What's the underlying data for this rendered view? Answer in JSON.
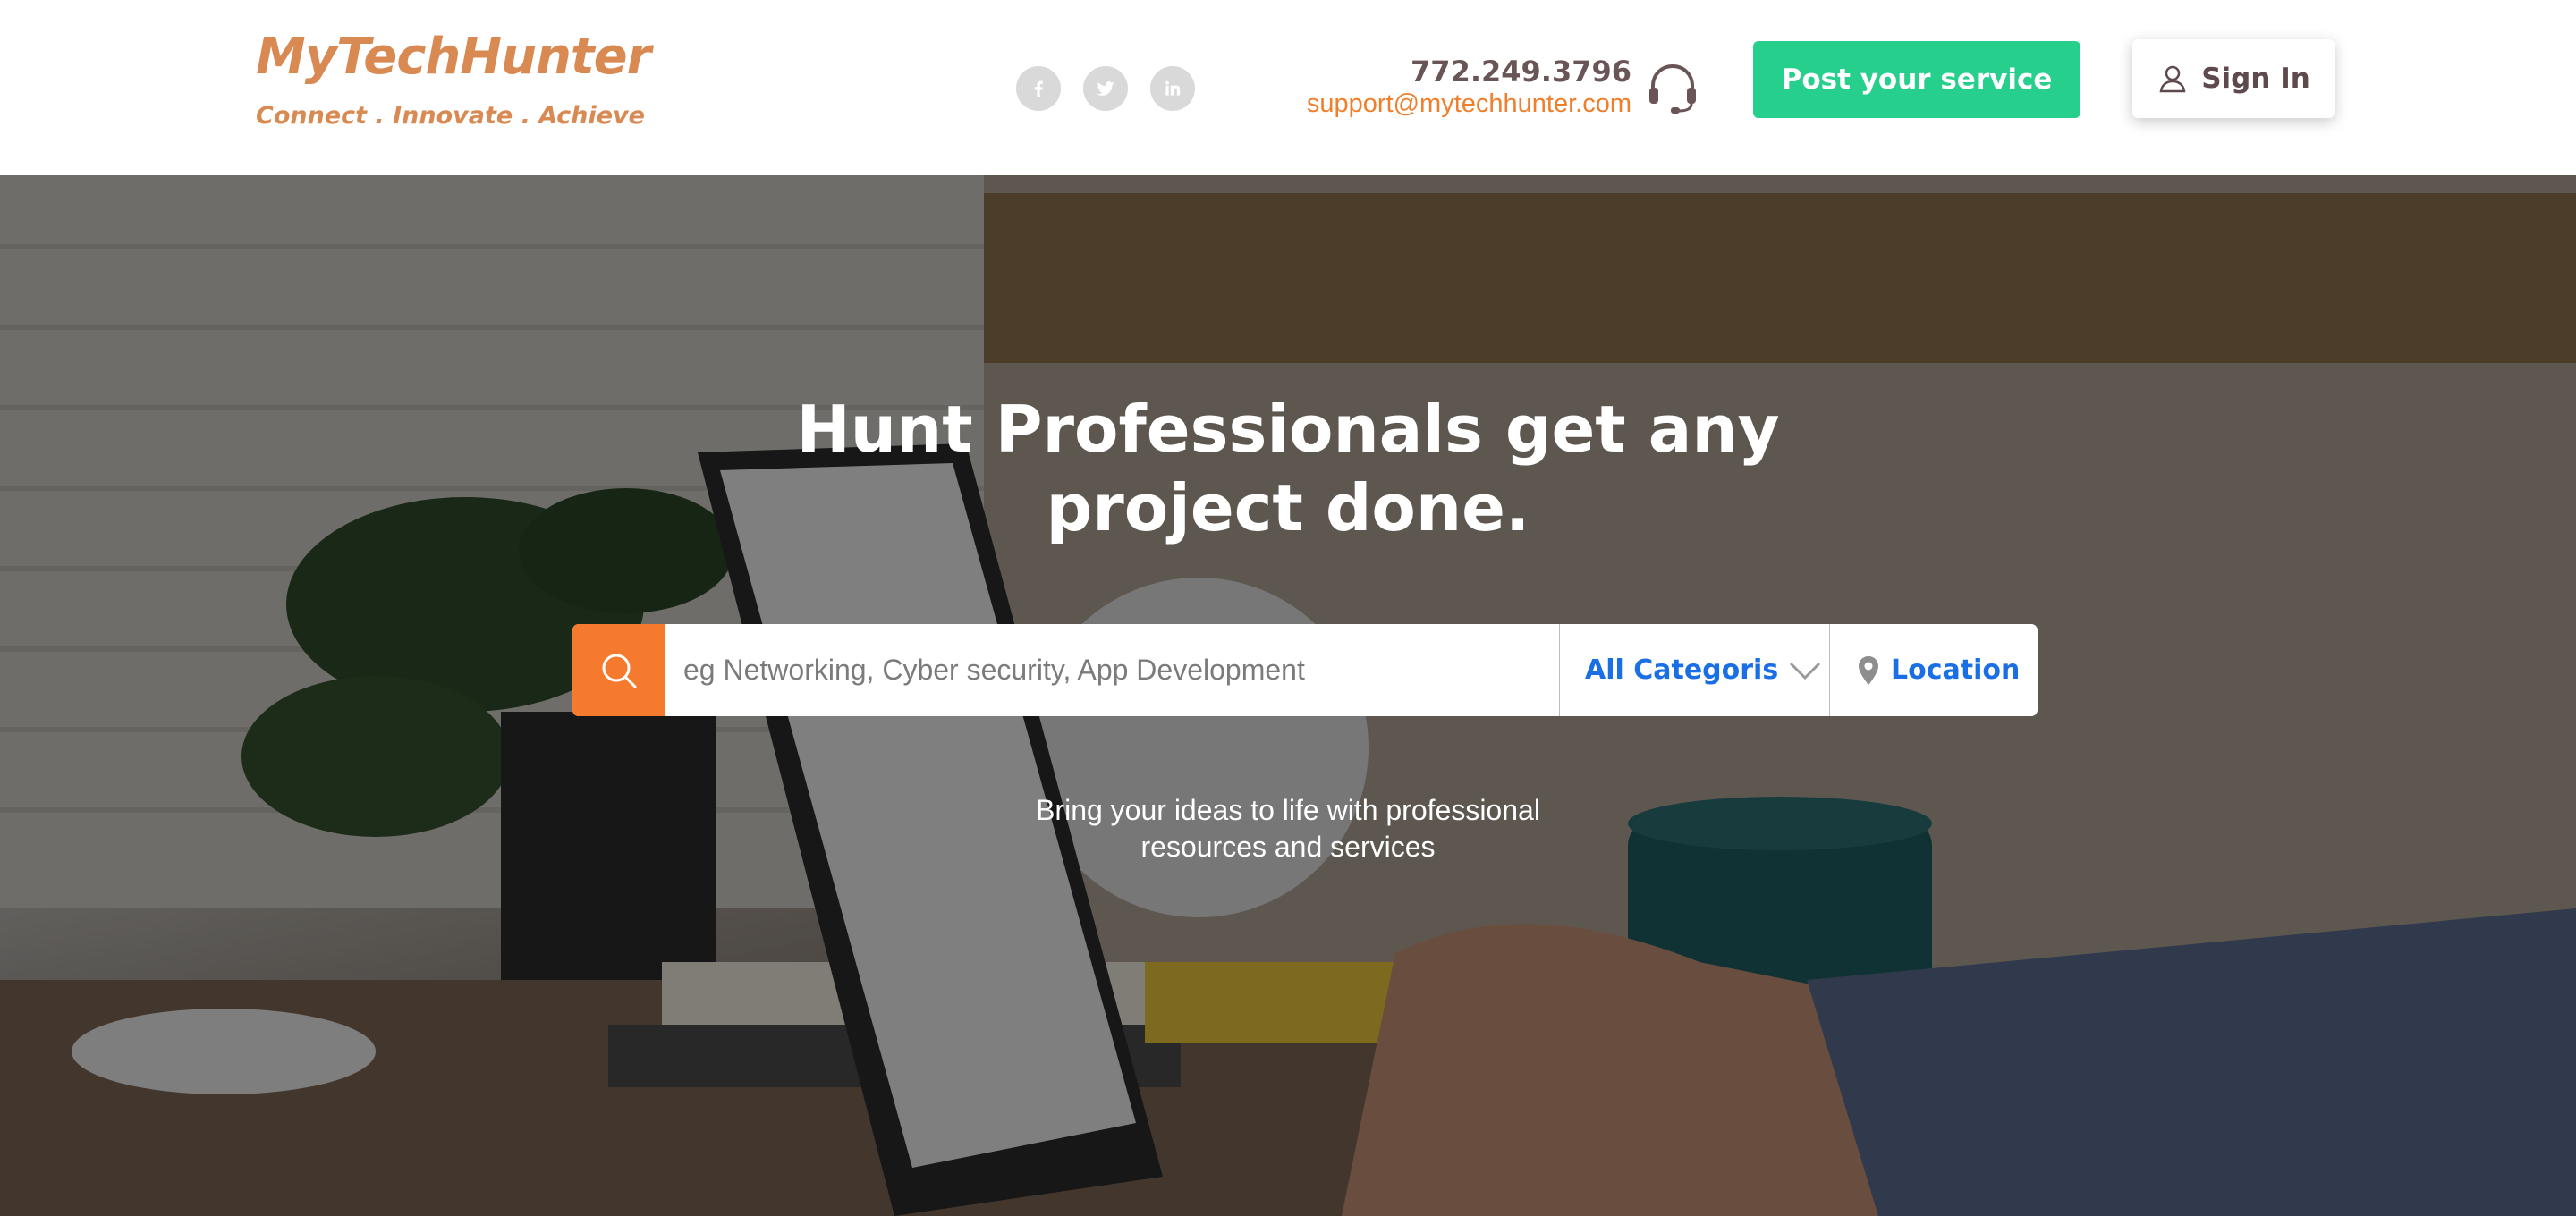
{
  "brand": {
    "name": "MyTechHunter",
    "tagline": "Connect . Innovate . Achieve"
  },
  "social": [
    {
      "name": "facebook-icon"
    },
    {
      "name": "twitter-icon"
    },
    {
      "name": "linkedin-icon"
    }
  ],
  "contact": {
    "phone": "772.249.3796",
    "email": "support@mytechhunter.com",
    "icon": "headset-icon"
  },
  "header": {
    "post_service_label": "Post your service",
    "signin_label": "Sign In"
  },
  "hero": {
    "title_line1": "Hunt Professionals get any",
    "title_line2": "project done.",
    "subtitle_line1": "Bring your ideas to life with professional",
    "subtitle_line2": "resources and services"
  },
  "search": {
    "placeholder": "eg Networking, Cyber security, App Development",
    "value": "",
    "category_label": "All Categoris",
    "location_label": "Location"
  },
  "colors": {
    "brand": "#d88a52",
    "accent_green": "#27cf8d",
    "search_orange": "#f67a2d",
    "link_blue": "#1a6fe4",
    "email_orange": "#f07f2c"
  }
}
